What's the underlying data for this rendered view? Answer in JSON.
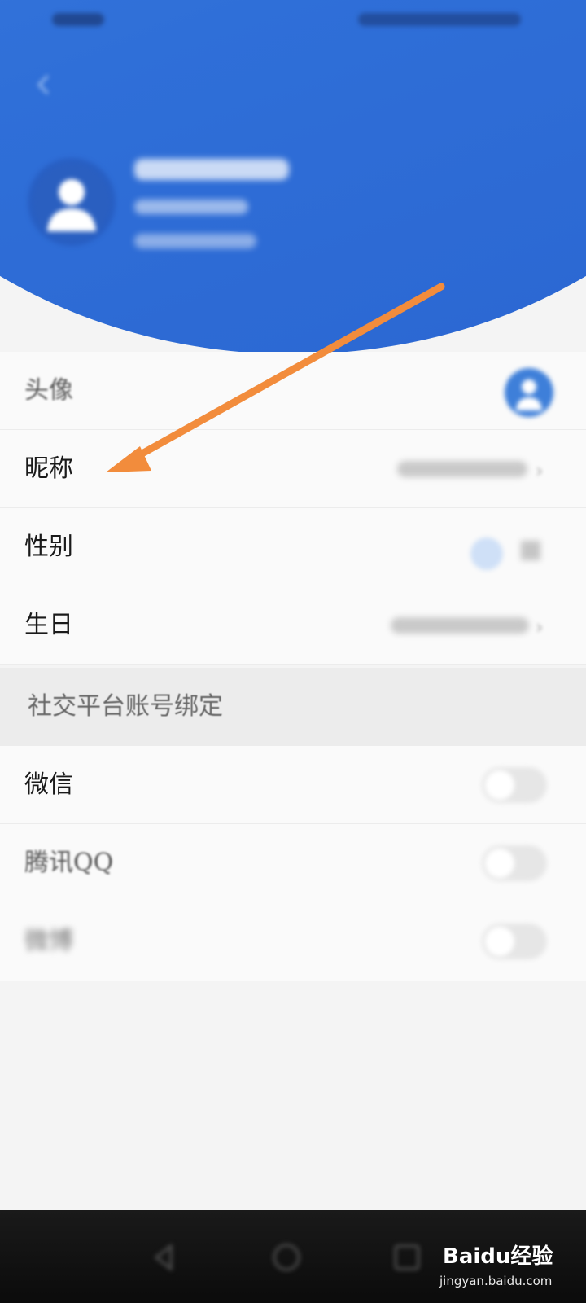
{
  "rows": {
    "avatar": "头像",
    "nickname": "昵称",
    "gender": "性别",
    "birthday": "生日",
    "section_social": "社交平台账号绑定",
    "wechat": "微信",
    "qq": "腾讯QQ",
    "weibo": "微博"
  },
  "watermark": {
    "brand": "Bai",
    "brand_mid": "du",
    "brand_suffix": "经验",
    "url": "jingyan.baidu.com"
  },
  "colors": {
    "header_blue": "#2f6fd8",
    "annotation_arrow": "#f28c3c"
  },
  "icons": {
    "back": "back-arrow-icon",
    "avatar": "user-avatar-icon",
    "chevron": "chevron-right-icon"
  }
}
